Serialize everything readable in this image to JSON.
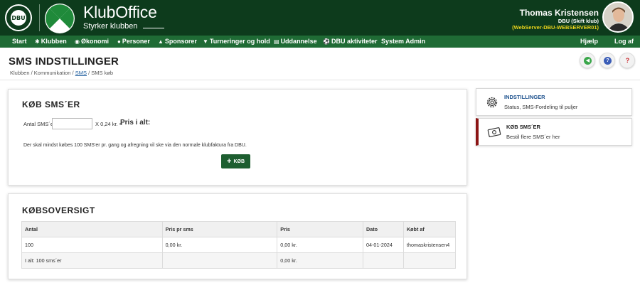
{
  "header": {
    "brand_title": "KlubOffice",
    "brand_subtitle": "Styrker klubben",
    "user_name": "Thomas Kristensen",
    "user_club": "DBU (Skift klub)",
    "user_server": "(WebServer-DBU-WEBSERVER01)"
  },
  "nav": {
    "items": [
      {
        "label": "Start",
        "icon": ""
      },
      {
        "label": "Klubben",
        "icon": "users-icon"
      },
      {
        "label": "Økonomi",
        "icon": "coin-icon"
      },
      {
        "label": "Personer",
        "icon": "person-icon"
      },
      {
        "label": "Sponsorer",
        "icon": "sponsor-icon"
      },
      {
        "label": "Turneringer og hold",
        "icon": "trophy-icon"
      },
      {
        "label": "Uddannelse",
        "icon": "education-icon"
      },
      {
        "label": "DBU aktiviteter",
        "icon": "ball-icon"
      },
      {
        "label": "System Admin",
        "icon": ""
      }
    ],
    "help": "Hjælp",
    "logout": "Log af"
  },
  "page": {
    "title": "SMS INDSTILLINGER",
    "breadcrumb_1": "Klubben / Kommunikation /",
    "breadcrumb_link": "SMS",
    "breadcrumb_2": "/ SMS køb"
  },
  "buy": {
    "title": "KØB SMS´ER",
    "qty_label": "Antal SMS´er",
    "qty_value": "",
    "price_text": "X  0,24 kr.  =",
    "total_label": "Pris i alt:",
    "info": "Der skal mindst købes 100 SMS'er pr. gang og afregning vil ske via den normale klubfaktura fra DBU.",
    "button": "KØB"
  },
  "overview": {
    "title": "KØBSOVERSIGT",
    "columns": [
      "Antal",
      "Pris pr sms",
      "Pris",
      "Dato",
      "Købt af"
    ],
    "rows": [
      [
        "100",
        "0,00 kr.",
        "0,00 kr.",
        "04-01-2024",
        "thomaskristensen4"
      ]
    ],
    "summary": [
      "I alt: 100 sms´er",
      "",
      "0,00 kr.",
      "",
      ""
    ]
  },
  "sidebar": {
    "cards": [
      {
        "title": "INDSTILLINGER",
        "subtitle": "Status, SMS-Fordeling til puljer",
        "title_color": "#1a4f8c"
      },
      {
        "title": "KØB SMS´ER",
        "subtitle": "Bestil flere SMS´er her",
        "title_color": "#222222"
      }
    ]
  },
  "colors": {
    "topbar": "#0d3b1c",
    "navbar": "#1f6b35",
    "accent_active": "#8b1414",
    "server_text": "#e8d21b"
  }
}
